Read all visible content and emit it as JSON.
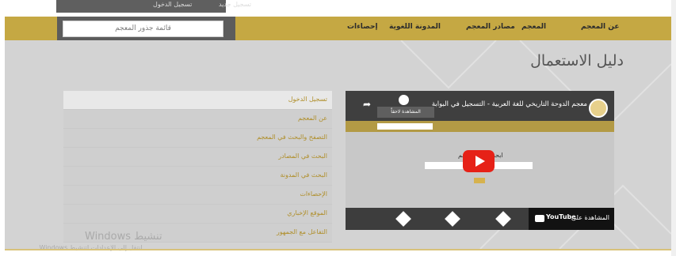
{
  "topbar": {
    "item1": "تسجيل الدخول",
    "item2": "تسجيل جديد"
  },
  "navbar": {
    "roots_label": "قائمة جذور المعجم",
    "items": [
      "عن المعجم",
      "المعجم",
      "مصادر المعجم",
      "المدونة اللغوية",
      "إحصاءات"
    ]
  },
  "page": {
    "title": "دليل الاستعمال"
  },
  "menu": {
    "items": [
      "تسجيل الدخول",
      "عن المعجم",
      "التصفح والبحث في المعجم",
      "البحث في المصادر",
      "البحث في المدونة",
      "الإحصاءات",
      "الموقع الإخباري",
      "التفاعل مع الجمهور"
    ]
  },
  "video": {
    "title": "معجم الدوحة التاريخي للغة العربية - التسجيل في البوابة",
    "tooltip": "المشاهدة لاحقاً",
    "inner_title": "ابحث في المعجم",
    "watch_on": "المشاهدة على",
    "youtube": "YouTube"
  },
  "watermark": {
    "line1": "تنشيط Windows",
    "line2": "انتقل إلى الإعدادات لتنشيط Windows."
  },
  "colors": {
    "gold": "#c5a843",
    "dark": "#5c5c5c",
    "bg": "#d3d3d3",
    "menu_text": "#b08f2b",
    "youtube_red": "#e62117"
  }
}
